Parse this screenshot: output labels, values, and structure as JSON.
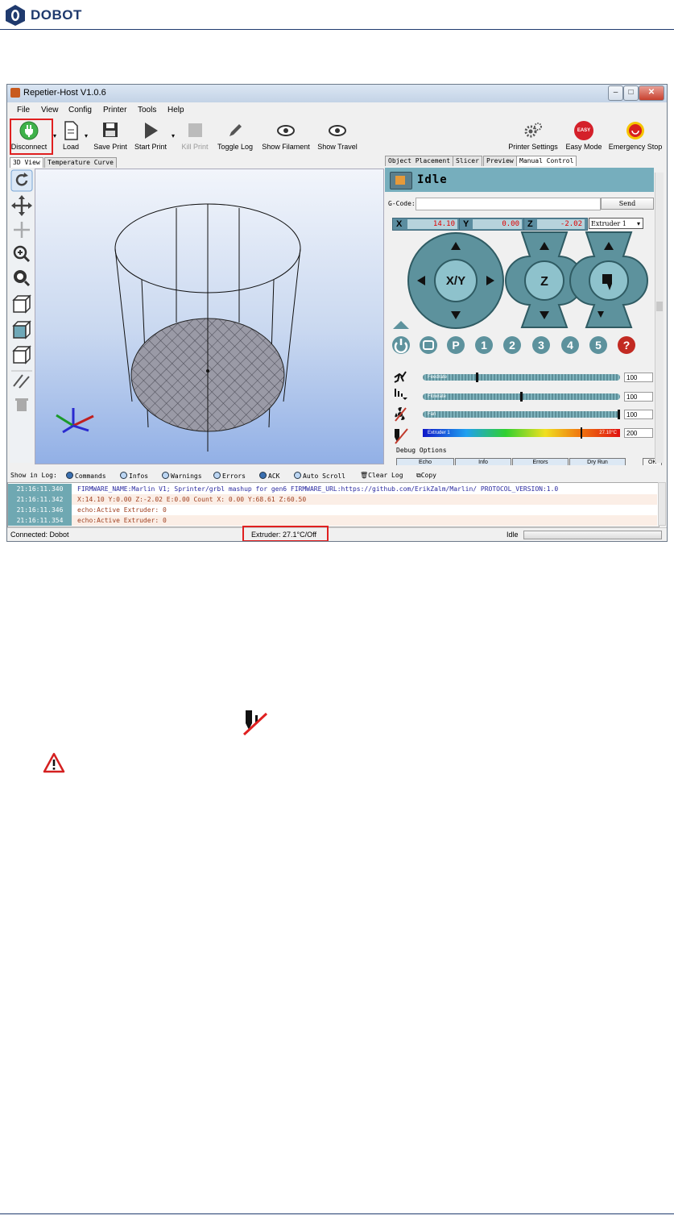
{
  "brand": {
    "name": "DOBOT"
  },
  "window": {
    "title": "Repetier-Host V1.0.6",
    "controls": [
      "–",
      "□",
      "✕"
    ]
  },
  "menu": [
    "File",
    "View",
    "Config",
    "Printer",
    "Tools",
    "Help"
  ],
  "toolbar": {
    "disconnect": "Disconnect",
    "load": "Load",
    "save_print": "Save Print",
    "start_print": "Start Print",
    "kill_print": "Kill Print",
    "toggle_log": "Toggle Log",
    "show_filament": "Show Filament",
    "show_travel": "Show Travel",
    "printer_settings": "Printer Settings",
    "easy_mode": "Easy Mode",
    "easy_badge": "EASY",
    "emergency_stop": "Emergency Stop"
  },
  "left_tabs": [
    "3D View",
    "Temperature Curve"
  ],
  "right_tabs": [
    "Object Placement",
    "Slicer",
    "Preview",
    "Manual Control"
  ],
  "manual": {
    "status": "Idle",
    "gcode_label": "G-Code:",
    "send": "Send",
    "x_label": "X",
    "x_value": "14.10",
    "y_label": "Y",
    "y_value": "0.00",
    "z_label": "Z",
    "z_value": "-2.02",
    "extruder_select": "Extruder 1",
    "xy_label": "X/Y",
    "z_btn": "Z",
    "buttons": [
      "P",
      "1",
      "2",
      "3",
      "4",
      "5",
      "?"
    ],
    "feedrate_label": "Feedrate",
    "feedrate_value": "100",
    "flowrate_label": "Flowrate",
    "flowrate_value": "100",
    "fan_label": "Fan",
    "fan_value": "100",
    "extruder_label": "Extruder 1",
    "extruder_temp": "27.10°C",
    "extruder_target": "200",
    "debug_label": "Debug Options",
    "debug_buttons": [
      "Echo",
      "Info",
      "Errors",
      "Dry Run"
    ],
    "ok": "OK"
  },
  "log_options": {
    "show_in_log": "Show in Log:",
    "items": [
      "Commands",
      "Infos",
      "Warnings",
      "Errors",
      "ACK",
      "Auto Scroll"
    ],
    "clear": "Clear Log",
    "copy": "Copy"
  },
  "log": [
    {
      "time": "21:16:11.340",
      "msg": "FIRMWARE_NAME:Marlin V1; Sprinter/grbl mashup for gen6 FIRMWARE_URL:https://github.com/ErikZalm/Marlin/ PROTOCOL_VERSION:1.0"
    },
    {
      "time": "21:16:11.342",
      "msg": "X:14.10 Y:0.00 Z:-2.02 E:0.00 Count X: 0.00 Y:68.61 Z:60.50"
    },
    {
      "time": "21:16:11.346",
      "msg": "echo:Active Extruder: 0"
    },
    {
      "time": "21:16:11.354",
      "msg": "echo:Active Extruder: 0"
    }
  ],
  "status": {
    "connected": "Connected: Dobot",
    "extruder": "Extruder: 27.1°C/Off",
    "idle": "Idle"
  },
  "colors": {
    "brand": "#1f3a6e",
    "highlight": "#e02020",
    "panel_teal": "#76aebd"
  }
}
